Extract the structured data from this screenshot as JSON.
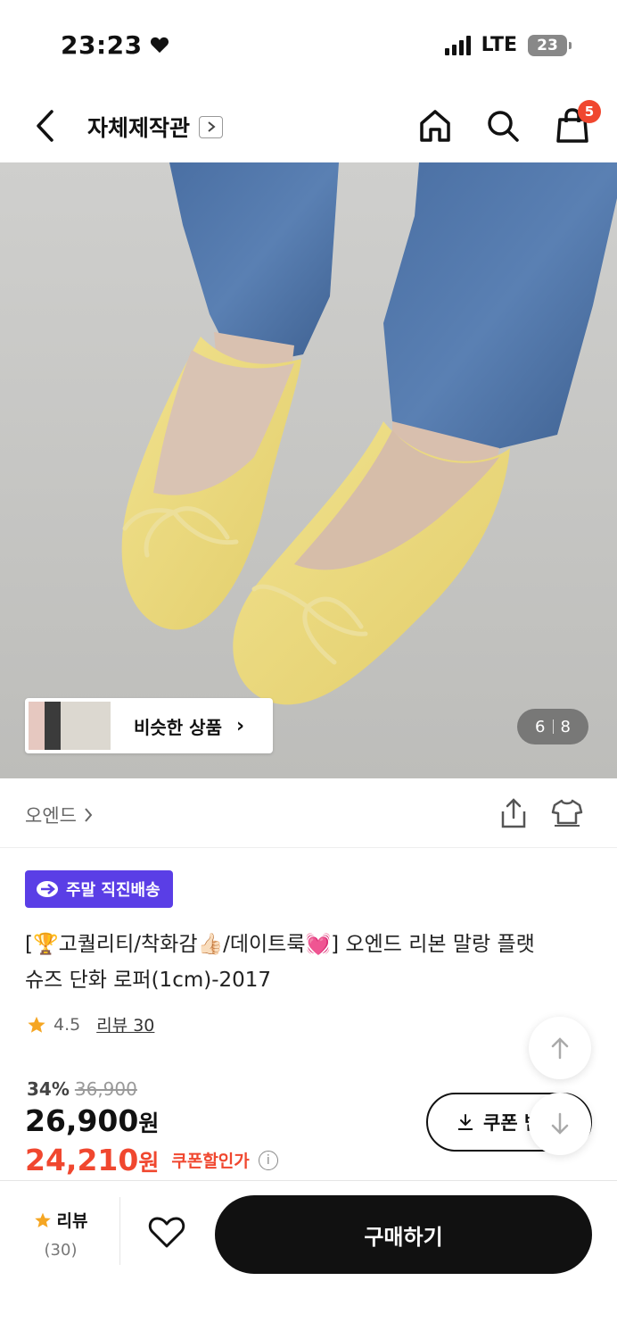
{
  "status_bar": {
    "time": "23:23",
    "network": "LTE",
    "battery": "23"
  },
  "header": {
    "shop_name": "자체제작관",
    "cart_count": "5"
  },
  "gallery": {
    "similar_label": "비슷한 상품",
    "current": "6",
    "total": "8"
  },
  "brand": {
    "name": "오엔드"
  },
  "shipping_badge": "주말 직진배송",
  "product": {
    "title_line1": "[🏆고퀄리티/착화감👍🏻/데이트룩💓] 오엔드 리본 말랑 플랫",
    "title_line2": "슈즈 단화 로퍼(1cm)-2017",
    "rating": "4.5",
    "review_label": "리뷰 30",
    "discount_pct": "34%",
    "original_price": "36,900",
    "price": "26,900",
    "price_unit": "원",
    "coupon_price": "24,210",
    "coupon_price_unit": "원",
    "coupon_price_label": "쿠폰할인가"
  },
  "coupon_button": "쿠폰 받",
  "bottom_bar": {
    "review_label": "리뷰",
    "review_count": "(30)",
    "buy_label": "구매하기"
  },
  "colors": {
    "accent_red": "#f0472f",
    "badge_purple": "#5a3ee6",
    "buy_button": "#111111"
  }
}
